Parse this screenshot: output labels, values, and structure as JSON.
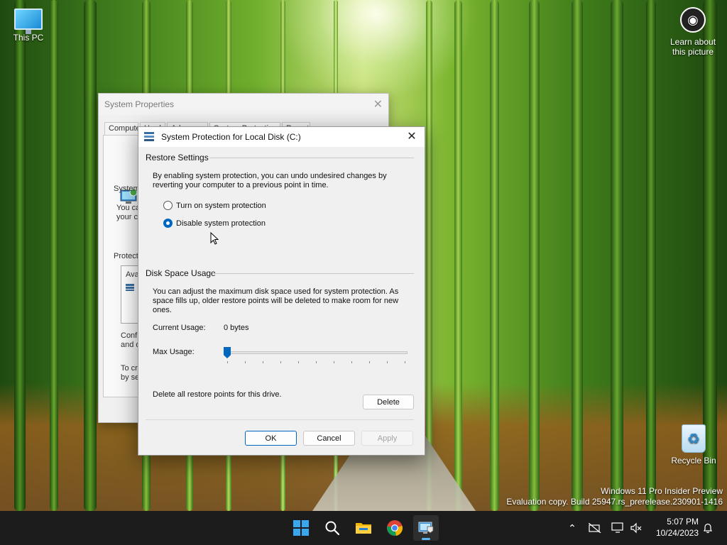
{
  "desktop": {
    "icons": {
      "this_pc": "This PC",
      "learn_line1": "Learn about",
      "learn_line2": "this picture",
      "recycle_bin": "Recycle Bin"
    },
    "watermark": {
      "line1": "Windows 11 Pro Insider Preview",
      "line2": "Evaluation copy. Build 25947.rs_prerelease.230901-1416"
    }
  },
  "system_properties": {
    "title": "System Properties",
    "tabs": [
      "Compute",
      "N",
      "Hardw",
      "Advanc",
      "System Protection",
      "Remote"
    ],
    "visible_fragments": {
      "system": "System",
      "you_can_1": "You ca",
      "you_can_2": "your co",
      "protection": "Protecti",
      "available": "Avai",
      "configure_1": "Confi",
      "configure_2": "and d",
      "to_create_1": "To cr",
      "to_create_2": "by se"
    }
  },
  "dialog": {
    "title": "System Protection for Local Disk (C:)",
    "restore_settings": {
      "heading": "Restore Settings",
      "description": "By enabling system protection, you can undo undesired changes by reverting your computer to a previous point in time.",
      "options": [
        {
          "label": "Turn on system protection",
          "checked": false
        },
        {
          "label": "Disable system protection",
          "checked": true
        }
      ]
    },
    "disk_space": {
      "heading": "Disk Space Usage",
      "description": "You can adjust the maximum disk space used for system protection. As space fills up, older restore points will be deleted to make room for new ones.",
      "current_usage_label": "Current Usage:",
      "current_usage_value": "0 bytes",
      "max_usage_label": "Max Usage:",
      "max_usage_fraction": 0.0
    },
    "delete_text": "Delete all restore points for this drive.",
    "buttons": {
      "delete": "Delete",
      "ok": "OK",
      "cancel": "Cancel",
      "apply": "Apply"
    }
  },
  "taskbar": {
    "apps": [
      "start-icon",
      "search-icon",
      "file-explorer-icon",
      "chrome-icon",
      "system-properties-icon"
    ],
    "tray_icons": [
      "chevron-up-icon",
      "network-off-icon",
      "display-icon",
      "volume-muted-icon",
      "notification-bell-icon"
    ],
    "time": "5:07 PM",
    "date": "10/24/2023"
  },
  "colors": {
    "accent": "#0067c0",
    "taskbar": "#1c1c1c",
    "active_indicator": "#5fb2f2"
  }
}
